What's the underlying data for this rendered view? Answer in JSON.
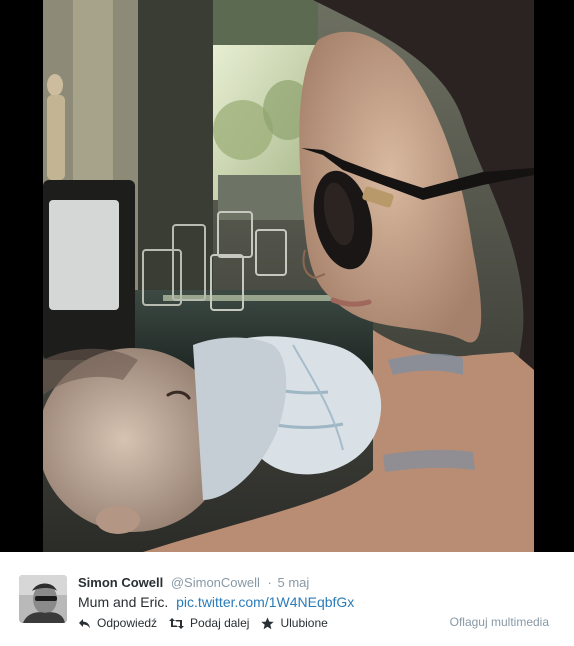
{
  "tweet": {
    "author_name": "Simon Cowell",
    "author_handle": "@SimonCowell",
    "timestamp_separator": "·",
    "timestamp": "5 maj",
    "text": "Mum and Eric.",
    "link": "pic.twitter.com/1W4NEqbfGx"
  },
  "actions": {
    "reply_label": "Odpowiedź",
    "retweet_label": "Podaj dalej",
    "favorite_label": "Ulubione",
    "reply_icon": "reply-arrow-icon",
    "retweet_icon": "retweet-icon",
    "favorite_icon": "star-icon"
  },
  "flag_media_label": "Oflaguj multimedia",
  "colors": {
    "link": "#2b7bb9",
    "muted": "#8899a6",
    "text": "#292f33",
    "media_background": "#000000"
  }
}
